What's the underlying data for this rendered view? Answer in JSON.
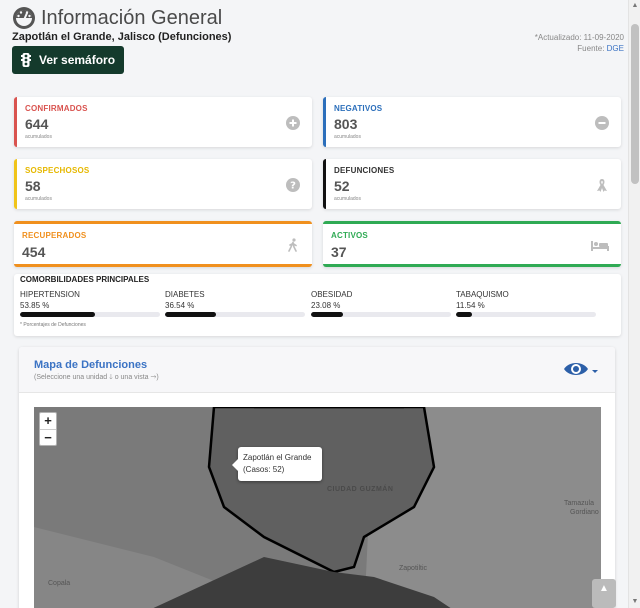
{
  "header": {
    "title": "Información General",
    "subtitle": "Zapotlán el Grande, Jalisco (Defunciones)",
    "semaforo_button": "Ver semáforo",
    "updated": "*Actualizado: 11-09-2020",
    "source_prefix": "Fuente:",
    "source": "DGE"
  },
  "cards": {
    "confirmados": {
      "label": "CONFIRMADOS",
      "value": "644",
      "sub": "acumulados",
      "icon": "plus-circle-icon",
      "color": "#d9534f"
    },
    "negativos": {
      "label": "NEGATIVOS",
      "value": "803",
      "sub": "acumulados",
      "icon": "minus-circle-icon",
      "color": "#2c6fbb"
    },
    "sospechosos": {
      "label": "SOSPECHOSOS",
      "value": "58",
      "sub": "acumulados",
      "icon": "question-circle-icon",
      "color": "#e6b800"
    },
    "defunciones": {
      "label": "DEFUNCIONES",
      "value": "52",
      "sub": "acumulados",
      "icon": "ribbon-icon",
      "color": "#333333"
    },
    "recuperados": {
      "label": "RECUPERADOS",
      "value": "454",
      "icon": "walking-person-icon",
      "color": "#f0901e"
    },
    "activos": {
      "label": "ACTIVOS",
      "value": "37",
      "icon": "bed-icon",
      "color": "#2faa54"
    }
  },
  "comorbilidades": {
    "title": "COMORBILIDADES PRINCIPALES",
    "items": [
      {
        "name": "HIPERTENSION",
        "percent": "53.85 %",
        "value": 53.85
      },
      {
        "name": "DIABETES",
        "percent": "36.54 %",
        "value": 36.54
      },
      {
        "name": "OBESIDAD",
        "percent": "23.08 %",
        "value": 23.08
      },
      {
        "name": "TABAQUISMO",
        "percent": "11.54 %",
        "value": 11.54
      }
    ],
    "note": "* Porcentajes de Defunciones"
  },
  "map": {
    "title": "Mapa de Defunciones",
    "subtitle": "(Seleccione una unidad 🡓 o una vista 🡒)",
    "zoom_in": "+",
    "zoom_out": "−",
    "tooltip_name": "Zapotlán el Grande",
    "tooltip_cases": "(Casos: 52)",
    "labels": {
      "ciudad": "CIUDAD GUZMÁN",
      "tamazula": "Tamazula",
      "gordiano": "Gordiano",
      "zapotiltic": "Zapotiltic",
      "copala": "Copala"
    }
  },
  "colors": {
    "accent": "#3b73c4",
    "button_dark": "#143a2c",
    "icon_grey": "#bdbdbd"
  }
}
